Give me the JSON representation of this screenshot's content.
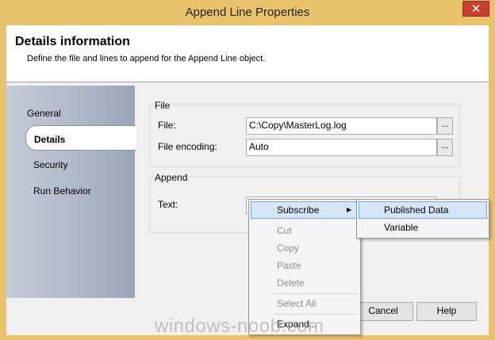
{
  "window": {
    "title": "Append Line Properties",
    "close_glyph": "✕"
  },
  "header": {
    "title": "Details information",
    "description": "Define the file and lines to append for the Append Line object."
  },
  "nav": {
    "items": [
      {
        "label": "General",
        "selected": false
      },
      {
        "label": "Details",
        "selected": true
      },
      {
        "label": "Security",
        "selected": false
      },
      {
        "label": "Run Behavior",
        "selected": false
      }
    ]
  },
  "file_group": {
    "label": "File",
    "file_label": "File:",
    "file_value": "C:\\Copy\\MasterLog.log",
    "encoding_label": "File encoding:",
    "encoding_value": "Auto",
    "browse_label": "..."
  },
  "append_group": {
    "label": "Append",
    "text_label": "Text:",
    "text_value": ""
  },
  "buttons": {
    "cancel": "Cancel",
    "help": "Help"
  },
  "context_menu": {
    "subscribe": "Subscribe",
    "cut": "Cut",
    "copy": "Copy",
    "paste": "Paste",
    "delete": "Delete",
    "select_all": "Select All",
    "expand": "Expand..."
  },
  "submenu": {
    "published_data": "Published Data",
    "variable": "Variable"
  },
  "watermark": "windows-noob.com",
  "colors": {
    "title_bar": "#e9c36b",
    "close_button": "#c7402d",
    "highlight": "#d7e6f7"
  }
}
